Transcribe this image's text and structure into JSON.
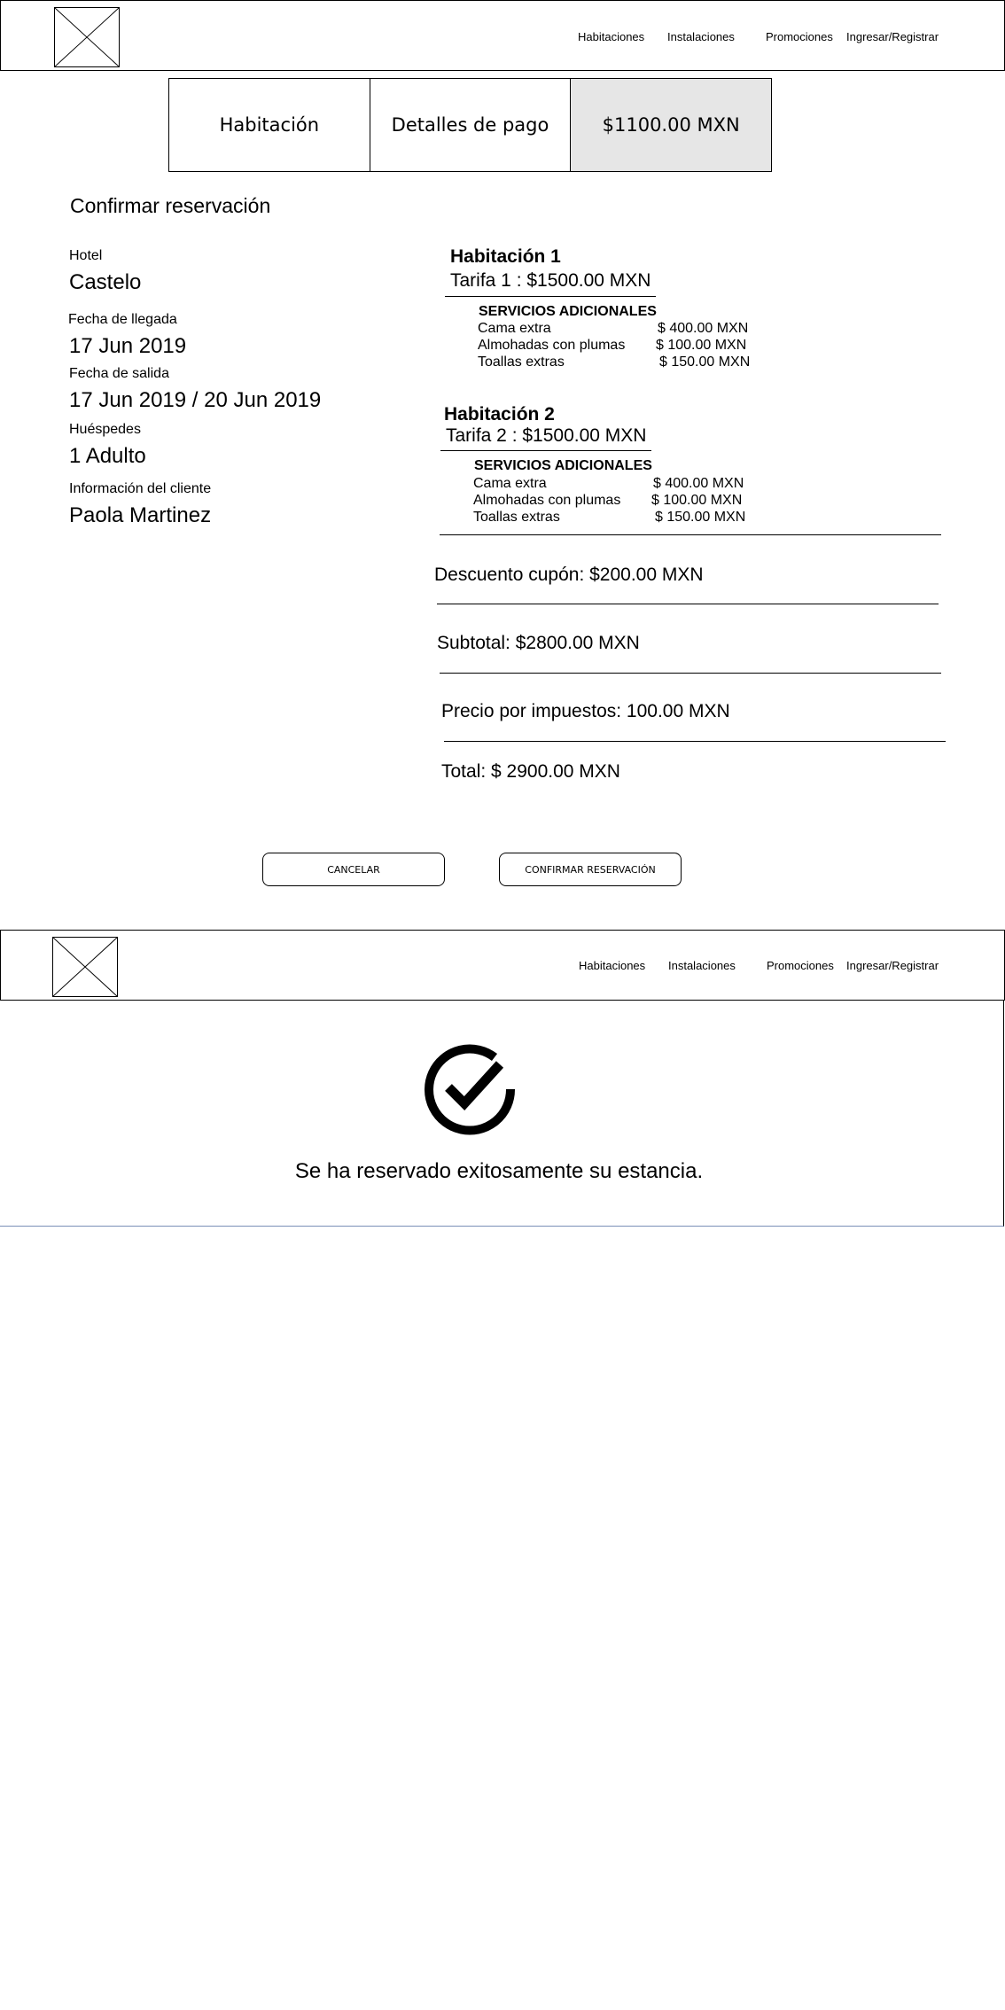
{
  "nav": {
    "items": [
      "Habitaciones",
      "Instalaciones",
      "Promociones",
      "Ingresar/Registrar"
    ]
  },
  "steps": [
    {
      "label": "Habitación",
      "active": false
    },
    {
      "label": "Detalles de pago",
      "active": false
    },
    {
      "label": "$1100.00 MXN",
      "active": true
    }
  ],
  "page_title": "Confirmar reservación",
  "details": {
    "hotel_label": "Hotel",
    "hotel_value": "Castelo",
    "arrival_label": "Fecha de llegada",
    "arrival_value": "17 Jun 2019",
    "departure_label": "Fecha de salida",
    "departure_value": "17 Jun 2019 / 20 Jun 2019",
    "guests_label": "Huéspedes",
    "guests_value": "1 Adulto",
    "client_label": "Información del cliente",
    "client_value": "Paola Martinez"
  },
  "rooms": [
    {
      "title": "Habitación 1",
      "rate": "Tarifa 1 : $1500.00 MXN",
      "services_heading": "SERVICIOS ADICIONALES",
      "services": [
        {
          "name": "Cama extra",
          "price": "$ 400.00 MXN"
        },
        {
          "name": "Almohadas con plumas",
          "price": "$ 100.00 MXN"
        },
        {
          "name": "Toallas extras",
          "price": "$ 150.00 MXN"
        }
      ]
    },
    {
      "title": "Habitación 2",
      "rate": "Tarifa 2 : $1500.00 MXN",
      "services_heading": "SERVICIOS ADICIONALES",
      "services": [
        {
          "name": "Cama extra",
          "price": "$ 400.00 MXN"
        },
        {
          "name": "Almohadas con plumas",
          "price": "$ 100.00 MXN"
        },
        {
          "name": "Toallas extras",
          "price": "$ 150.00 MXN"
        }
      ]
    }
  ],
  "summary": {
    "discount": "Descuento cupón: $200.00 MXN",
    "subtotal": "Subtotal: $2800.00 MXN",
    "taxes": "Precio por impuestos: 100.00 MXN",
    "total": "Total: $ 2900.00 MXN"
  },
  "buttons": {
    "cancel": "CANCELAR",
    "confirm": "CONFIRMAR RESERVACIÓN"
  },
  "success": {
    "icon": "check-circle-icon",
    "message": "Se ha reservado exitosamente su estancia."
  }
}
